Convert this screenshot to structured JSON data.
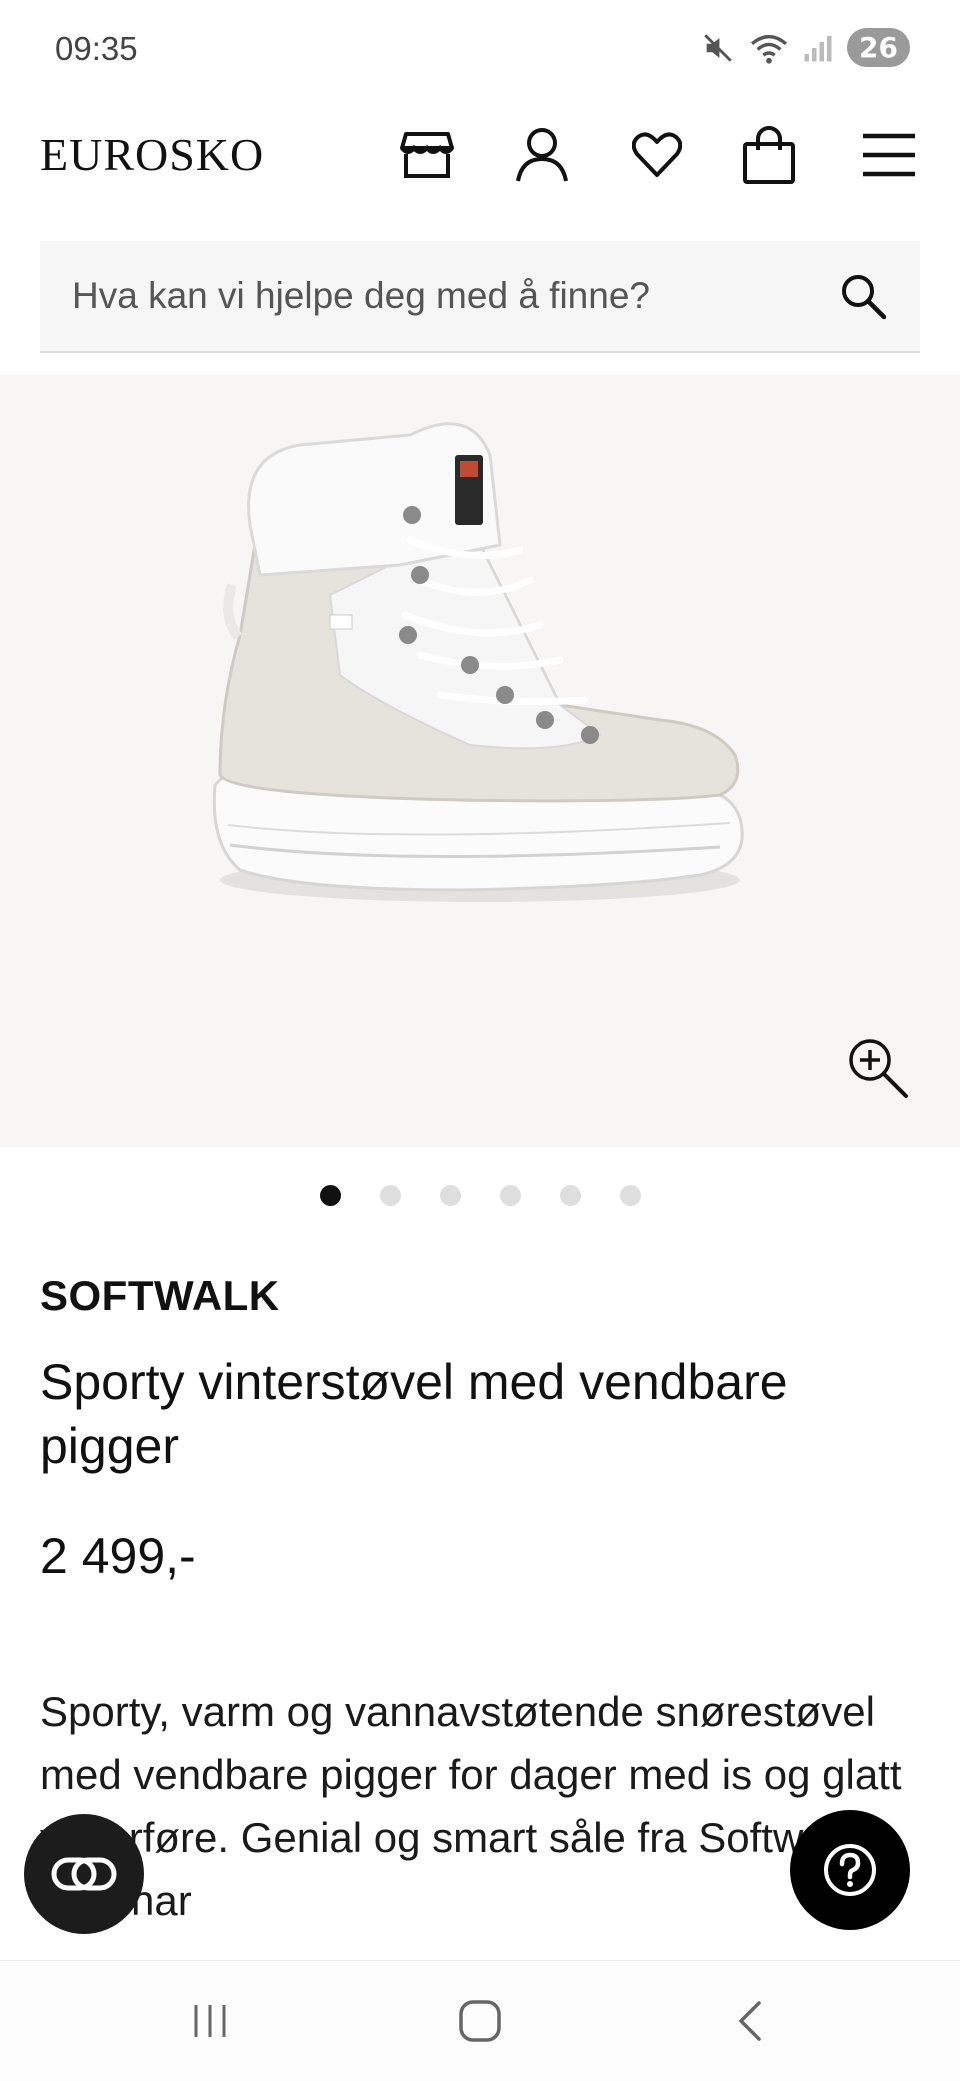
{
  "status_bar": {
    "time": "09:35",
    "battery": "26",
    "icons": [
      "mute-icon",
      "wifi-icon",
      "signal-icon"
    ]
  },
  "header": {
    "logo": "EUROSKO",
    "icons": [
      "store-icon",
      "account-icon",
      "wishlist-heart-icon",
      "cart-bag-icon",
      "menu-icon"
    ]
  },
  "search": {
    "placeholder": "Hva kan vi hjelpe deg med å finne?"
  },
  "gallery": {
    "image_count": 6,
    "active_index": 0,
    "background": "#f7f6f4"
  },
  "product": {
    "brand": "SOFTWALK",
    "title": "Sporty vinterstøvel med vendbare pigger",
    "price": "2 499,-",
    "description": "Sporty, varm og vannavstøtende snørestøvel med vendbare pigger for dager med is og glatt vinterføre. Genial og smart såle fra Softwalk som har"
  },
  "colors": {
    "accent": "#000000",
    "text": "#111111",
    "search_bg": "#f6f6f6"
  }
}
